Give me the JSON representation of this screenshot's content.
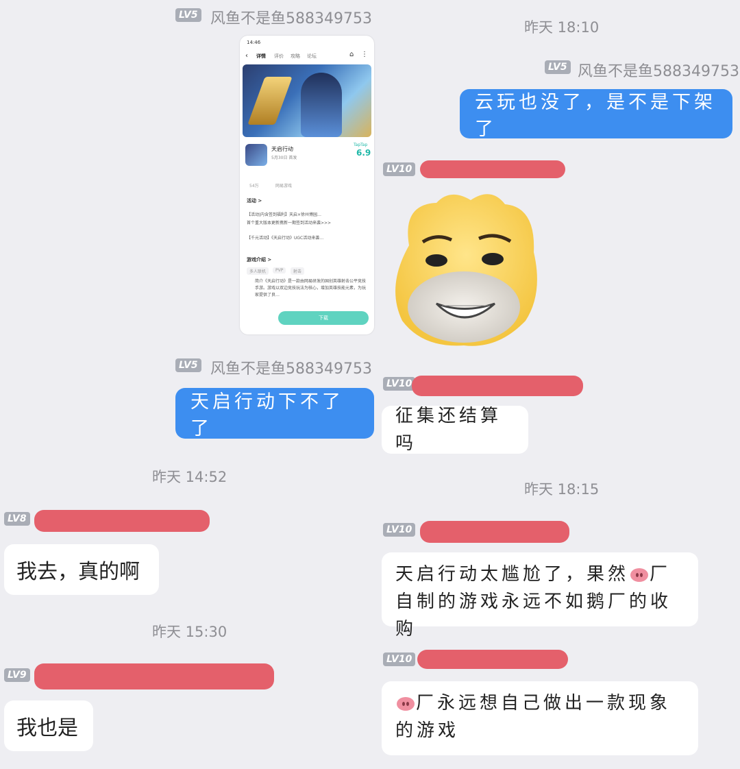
{
  "timestamps": {
    "t1": "昨天 18:10",
    "t2": "昨天 14:52",
    "t3": "昨天 18:15",
    "t4": "昨天 15:30"
  },
  "levels": {
    "lv5": "LV5",
    "lv8": "LV8",
    "lv9": "LV9",
    "lv10": "LV10"
  },
  "sender_main": "风鱼不是鱼588349753",
  "messages": {
    "blue_right": "云玩也没了，是不是下架了",
    "blue_left": "天启行动下不了了",
    "reply_jiesuan": "征集还结算吗",
    "reply_ganga_a": "天启行动太尴尬了，果然",
    "reply_ganga_b": "厂自制的游戏永远不如鹅厂的收购",
    "reply_pig_a": "厂永远想自己做出一款现象的游戏",
    "left_wo_qu": "我去，真的啊",
    "left_wo_ye": "我也是"
  },
  "phone": {
    "status_time": "14:46",
    "tabs": [
      "详情",
      "评价",
      "攻略",
      "论坛"
    ],
    "game_name": "天启行动",
    "game_sub": "5月30日 首发",
    "rating_label": "TapTap",
    "rating": "6.9",
    "stat_val": "54万",
    "stat_label": "网易游戏",
    "section_activity": "活动 >",
    "activity_1": "【活动|内含签到福利】天启×徐州博园…",
    "activity_1b": "首个重大版本更新携新一期签到活动来袭>>>",
    "activity_2": "【千元活动】《天启行动》UGC活动来袭…",
    "section_intro": "游戏介绍 >",
    "tags": [
      "多人联机",
      "PVP",
      "射击"
    ],
    "intro_text": "简介《天启行动》是一款由网易研发的国创英雄射击公平竞技手游。游戏以双边竞技玩法为核心，增加英雄技能元素，为玩家提供了良…",
    "download": "下载"
  },
  "colors": {
    "background": "#eeeef2",
    "blue_bubble": "#3d8ef0",
    "redaction": "#e4606b",
    "level_badge": "#a9adb6"
  }
}
